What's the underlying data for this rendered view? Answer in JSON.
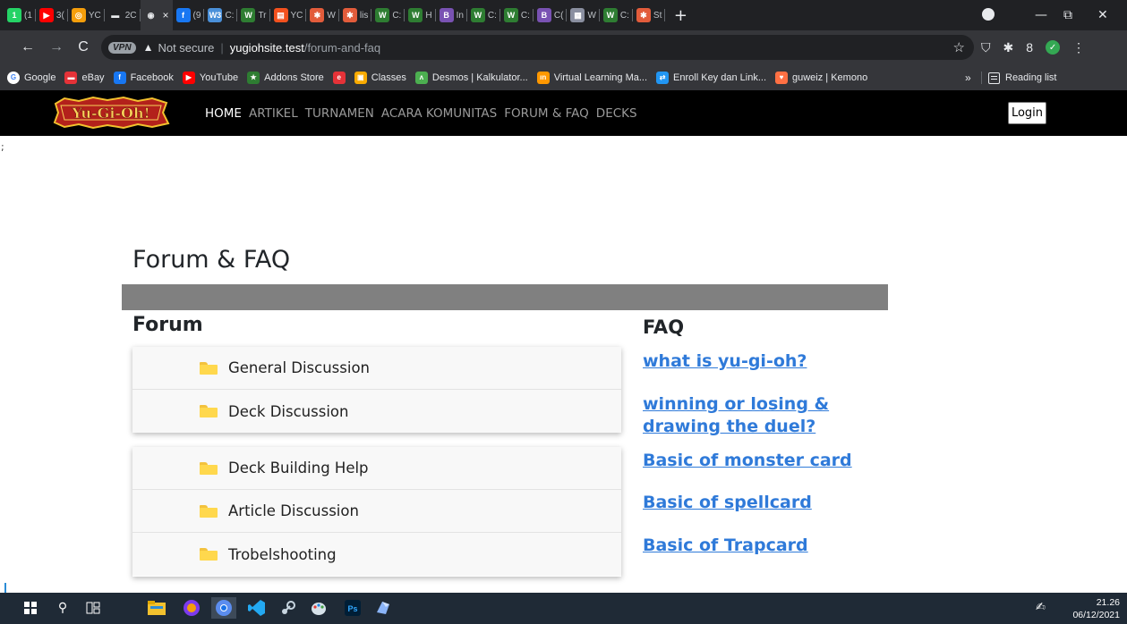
{
  "browser": {
    "tabs": [
      {
        "icon": "whatsapp-icon",
        "color": "#25d366",
        "glyph": "1",
        "text": "(1"
      },
      {
        "icon": "youtube-icon",
        "color": "#ff0000",
        "glyph": "▶",
        "text": "3("
      },
      {
        "icon": "orange-app-icon",
        "color": "#f59e0b",
        "glyph": "◎",
        "text": "YC"
      },
      {
        "icon": "monitor-icon",
        "color": "#e8eaed",
        "glyph": "▬",
        "text": "2C"
      },
      {
        "icon": "chrome-globe-icon",
        "color": "#e8eaed",
        "glyph": "◉",
        "text": "",
        "active": true
      },
      {
        "icon": "facebook-icon",
        "color": "#1877f2",
        "glyph": "f",
        "text": "(9"
      },
      {
        "icon": "w3schools-icon",
        "color": "#4a90d9",
        "glyph": "W3",
        "text": "C:"
      },
      {
        "icon": "w-green-icon",
        "color": "#2e7d32",
        "glyph": "W",
        "text": "Tr"
      },
      {
        "icon": "orange-book-icon",
        "color": "#f4511e",
        "glyph": "▤",
        "text": "YC"
      },
      {
        "icon": "asterisk-icon",
        "color": "#e25c3b",
        "glyph": "✱",
        "text": "W"
      },
      {
        "icon": "asterisk-icon",
        "color": "#e25c3b",
        "glyph": "✱",
        "text": "lis"
      },
      {
        "icon": "w-green-icon",
        "color": "#2e7d32",
        "glyph": "W",
        "text": "C:"
      },
      {
        "icon": "w-green-icon",
        "color": "#2e7d32",
        "glyph": "W",
        "text": "H"
      },
      {
        "icon": "bootstrap-icon",
        "color": "#7952b3",
        "glyph": "B",
        "text": "In"
      },
      {
        "icon": "w-green-icon",
        "color": "#2e7d32",
        "glyph": "W",
        "text": "C:"
      },
      {
        "icon": "w-green-icon",
        "color": "#2e7d32",
        "glyph": "W",
        "text": "C:"
      },
      {
        "icon": "bootstrap-icon",
        "color": "#7952b3",
        "glyph": "B",
        "text": "C("
      },
      {
        "icon": "image-icon",
        "color": "#8a8fa0",
        "glyph": "▦",
        "text": "W"
      },
      {
        "icon": "w-green-icon",
        "color": "#2e7d32",
        "glyph": "W",
        "text": "C:"
      },
      {
        "icon": "asterisk-icon",
        "color": "#e25c3b",
        "glyph": "✱",
        "text": "St"
      }
    ],
    "active_close": "×",
    "new_tab": "+",
    "window_controls": {
      "minimize": "—",
      "restore": "⧉",
      "close": "✕"
    },
    "address": {
      "vpn": "VPN",
      "warning_icon": "▲",
      "not_secure": "Not secure",
      "separator": "|",
      "host": "yugiohsite.test",
      "path": "/forum-and-faq"
    },
    "bookmarks": [
      {
        "label": "Google",
        "icon": "google-icon",
        "color": "#ffffff",
        "glyph": "G"
      },
      {
        "label": "eBay",
        "icon": "ebay-icon",
        "color": "#e53238",
        "glyph": "▬"
      },
      {
        "label": "Facebook",
        "icon": "facebook-icon",
        "color": "#1877f2",
        "glyph": "f"
      },
      {
        "label": "YouTube",
        "icon": "youtube-icon",
        "color": "#ff0000",
        "glyph": "▶"
      },
      {
        "label": "Addons Store",
        "icon": "addons-icon",
        "color": "#2e7d32",
        "glyph": "★"
      },
      {
        "label": "",
        "icon": "opera-icon",
        "color": "#e53238",
        "glyph": "e"
      },
      {
        "label": "Classes",
        "icon": "classroom-icon",
        "color": "#f9ab00",
        "glyph": "▣"
      },
      {
        "label": "Desmos | Kalkulator...",
        "icon": "desmos-icon",
        "color": "#4caf50",
        "glyph": "ʌ"
      },
      {
        "label": "Virtual Learning Ma...",
        "icon": "vlm-icon",
        "color": "#ff9800",
        "glyph": "ın"
      },
      {
        "label": "Enroll Key dan Link...",
        "icon": "link-icon",
        "color": "#2196f3",
        "glyph": "⇄"
      },
      {
        "label": "guweiz | Kemono",
        "icon": "kemono-icon",
        "color": "#ff7043",
        "glyph": "♥"
      }
    ],
    "bookmarks_more": "»",
    "reading_list": "Reading list"
  },
  "site": {
    "logo_text": "Yu-Gi-Oh!",
    "nav": [
      "HOME",
      "ARTIKEL",
      "TURNAMEN",
      "ACARA KOMUNITAS",
      "FORUM & FAQ",
      "DECKS"
    ],
    "login": "Login",
    "stray_char": ";"
  },
  "page": {
    "title": "Forum & FAQ",
    "forum_heading": "Forum",
    "faq_heading": "FAQ",
    "forum_group_1": [
      "General Discussion",
      "Deck Discussion"
    ],
    "forum_group_2": [
      "Deck Building Help",
      "Article Discussion",
      "Trobelshooting"
    ],
    "faq_links": [
      "what is yu-gi-oh?",
      "winning or losing & drawing the duel?",
      "Basic of monster card",
      "Basic of spellcard",
      "Basic of Trapcard"
    ]
  },
  "taskbar": {
    "time": "21.26",
    "date": "06/12/2021"
  }
}
